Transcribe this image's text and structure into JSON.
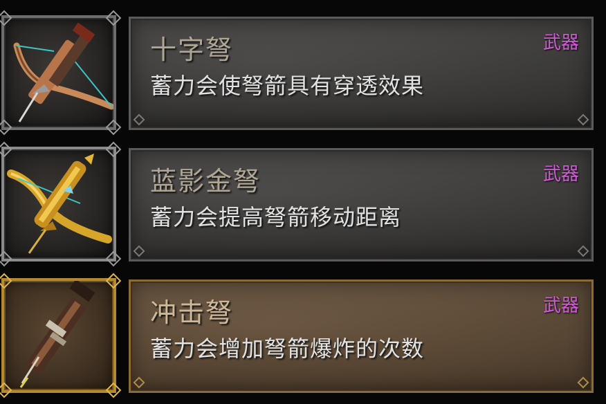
{
  "items": [
    {
      "name": "十字弩",
      "description": "蓄力会使弩箭具有穿透效果",
      "tag": "武器",
      "icon": "wooden-crossbow-icon"
    },
    {
      "name": "蓝影金弩",
      "description": "蓄力会提高弩箭移动距离",
      "tag": "武器",
      "icon": "golden-crossbow-icon"
    },
    {
      "name": "冲击弩",
      "description": "蓄力会增加弩箭爆炸的次数",
      "tag": "武器",
      "icon": "impact-crossbow-icon"
    }
  ],
  "colors": {
    "tag": "#d25ad8",
    "gold_frame": "#b58a2c",
    "panel": "#3a3937"
  }
}
